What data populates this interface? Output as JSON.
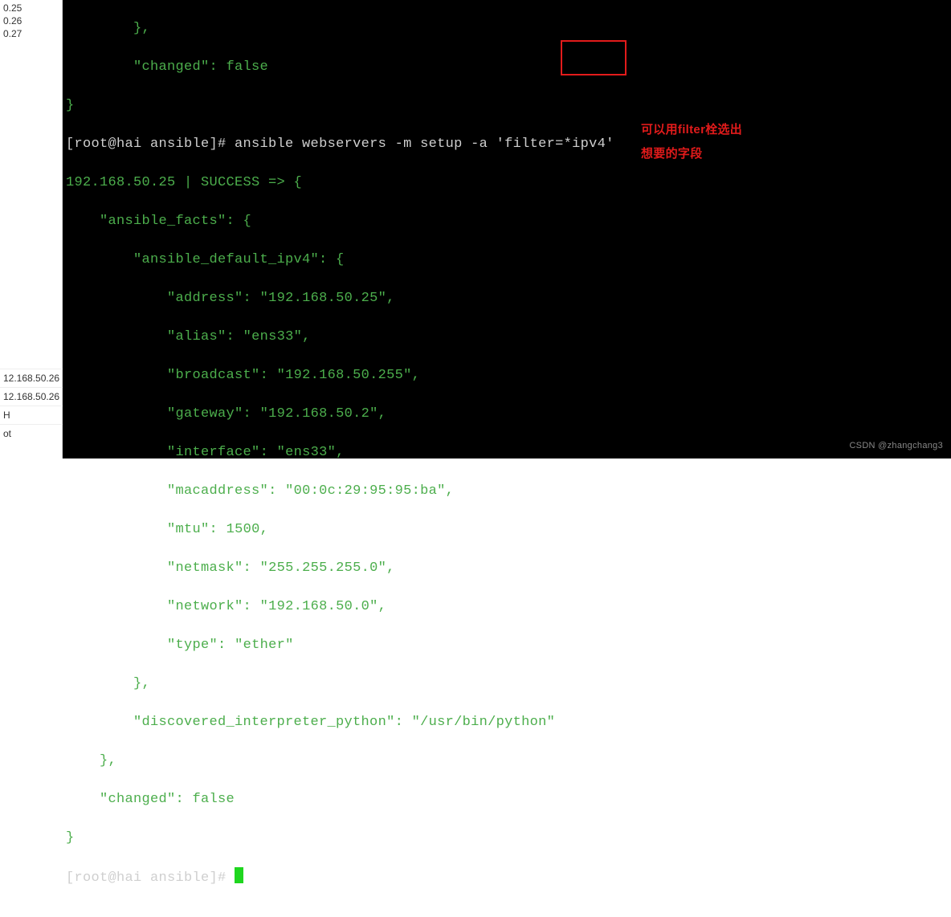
{
  "side_panel": {
    "top_items": [
      "0.25",
      "0.26",
      "0.27"
    ],
    "bottom_items": [
      "12.168.50.26",
      "12.168.50.26",
      "H",
      "ot"
    ]
  },
  "annotations": {
    "line1": "可以用filter栓选出",
    "line2": "想要的字段"
  },
  "watermark": "CSDN @zhangchang3",
  "terminal": {
    "pre_close1": "        },",
    "pre_changed_key": "\"changed\"",
    "pre_changed_val": "false",
    "pre_close2": "}",
    "prompt_user": "[root@hai ansible]# ",
    "command": "ansible webservers -m setup -a 'filter=*ipv4'",
    "status_line": "192.168.50.25 | SUCCESS => {",
    "facts_key": "\"ansible_facts\": {",
    "ipv4_key": "\"ansible_default_ipv4\": {",
    "kv": {
      "address_k": "\"address\"",
      "address_v": "\"192.168.50.25\",",
      "alias_k": "\"alias\"",
      "alias_v": "\"ens33\",",
      "broadcast_k": "\"broadcast\"",
      "broadcast_v": "\"192.168.50.255\",",
      "gateway_k": "\"gateway\"",
      "gateway_v": "\"192.168.50.2\",",
      "interface_k": "\"interface\"",
      "interface_v": "\"ens33\",",
      "mac_k": "\"macaddress\"",
      "mac_v": "\"00:0c:29:95:95:ba\",",
      "mtu_k": "\"mtu\"",
      "mtu_v": "1500,",
      "netmask_k": "\"netmask\"",
      "netmask_v": "\"255.255.255.0\",",
      "network_k": "\"network\"",
      "network_v": "\"192.168.50.0\",",
      "type_k": "\"type\"",
      "type_v": "\"ether\""
    },
    "close_ipv4": "        },",
    "interp_k": "\"discovered_interpreter_python\"",
    "interp_v": "\"/usr/bin/python\"",
    "close_facts": "    },",
    "changed_k": "\"changed\"",
    "changed_v": "false",
    "close_root": "}",
    "prompt2": "[root@hai ansible]# "
  }
}
